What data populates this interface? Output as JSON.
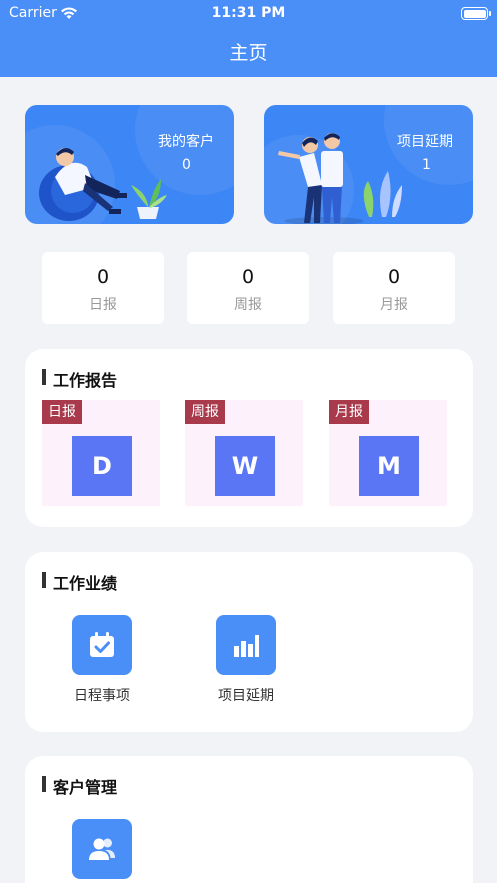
{
  "status_bar": {
    "carrier": "Carrier",
    "time": "11:31 PM"
  },
  "nav": {
    "title": "主页"
  },
  "hero": [
    {
      "label": "我的客户",
      "value": "0"
    },
    {
      "label": "项目延期",
      "value": "1"
    }
  ],
  "stats": [
    {
      "value": "0",
      "label": "日报"
    },
    {
      "value": "0",
      "label": "周报"
    },
    {
      "value": "0",
      "label": "月报"
    }
  ],
  "work_report": {
    "title": "工作报告",
    "items": [
      {
        "tag": "日报",
        "letter": "D"
      },
      {
        "tag": "周报",
        "letter": "W"
      },
      {
        "tag": "月报",
        "letter": "M"
      }
    ]
  },
  "work_performance": {
    "title": "工作业绩",
    "items": [
      {
        "label": "日程事项",
        "icon": "calendar-check-icon"
      },
      {
        "label": "项目延期",
        "icon": "bar-chart-icon"
      }
    ]
  },
  "customer_management": {
    "title": "客户管理",
    "items": [
      {
        "icon": "users-icon"
      }
    ]
  },
  "colors": {
    "primary": "#4a8ef7",
    "hero_card": "#3d86f5",
    "report_tag": "#a83a4c",
    "report_letter_bg": "#5b76f5",
    "report_bg": "#fdf1fb",
    "page_bg": "#f2f3f7"
  }
}
